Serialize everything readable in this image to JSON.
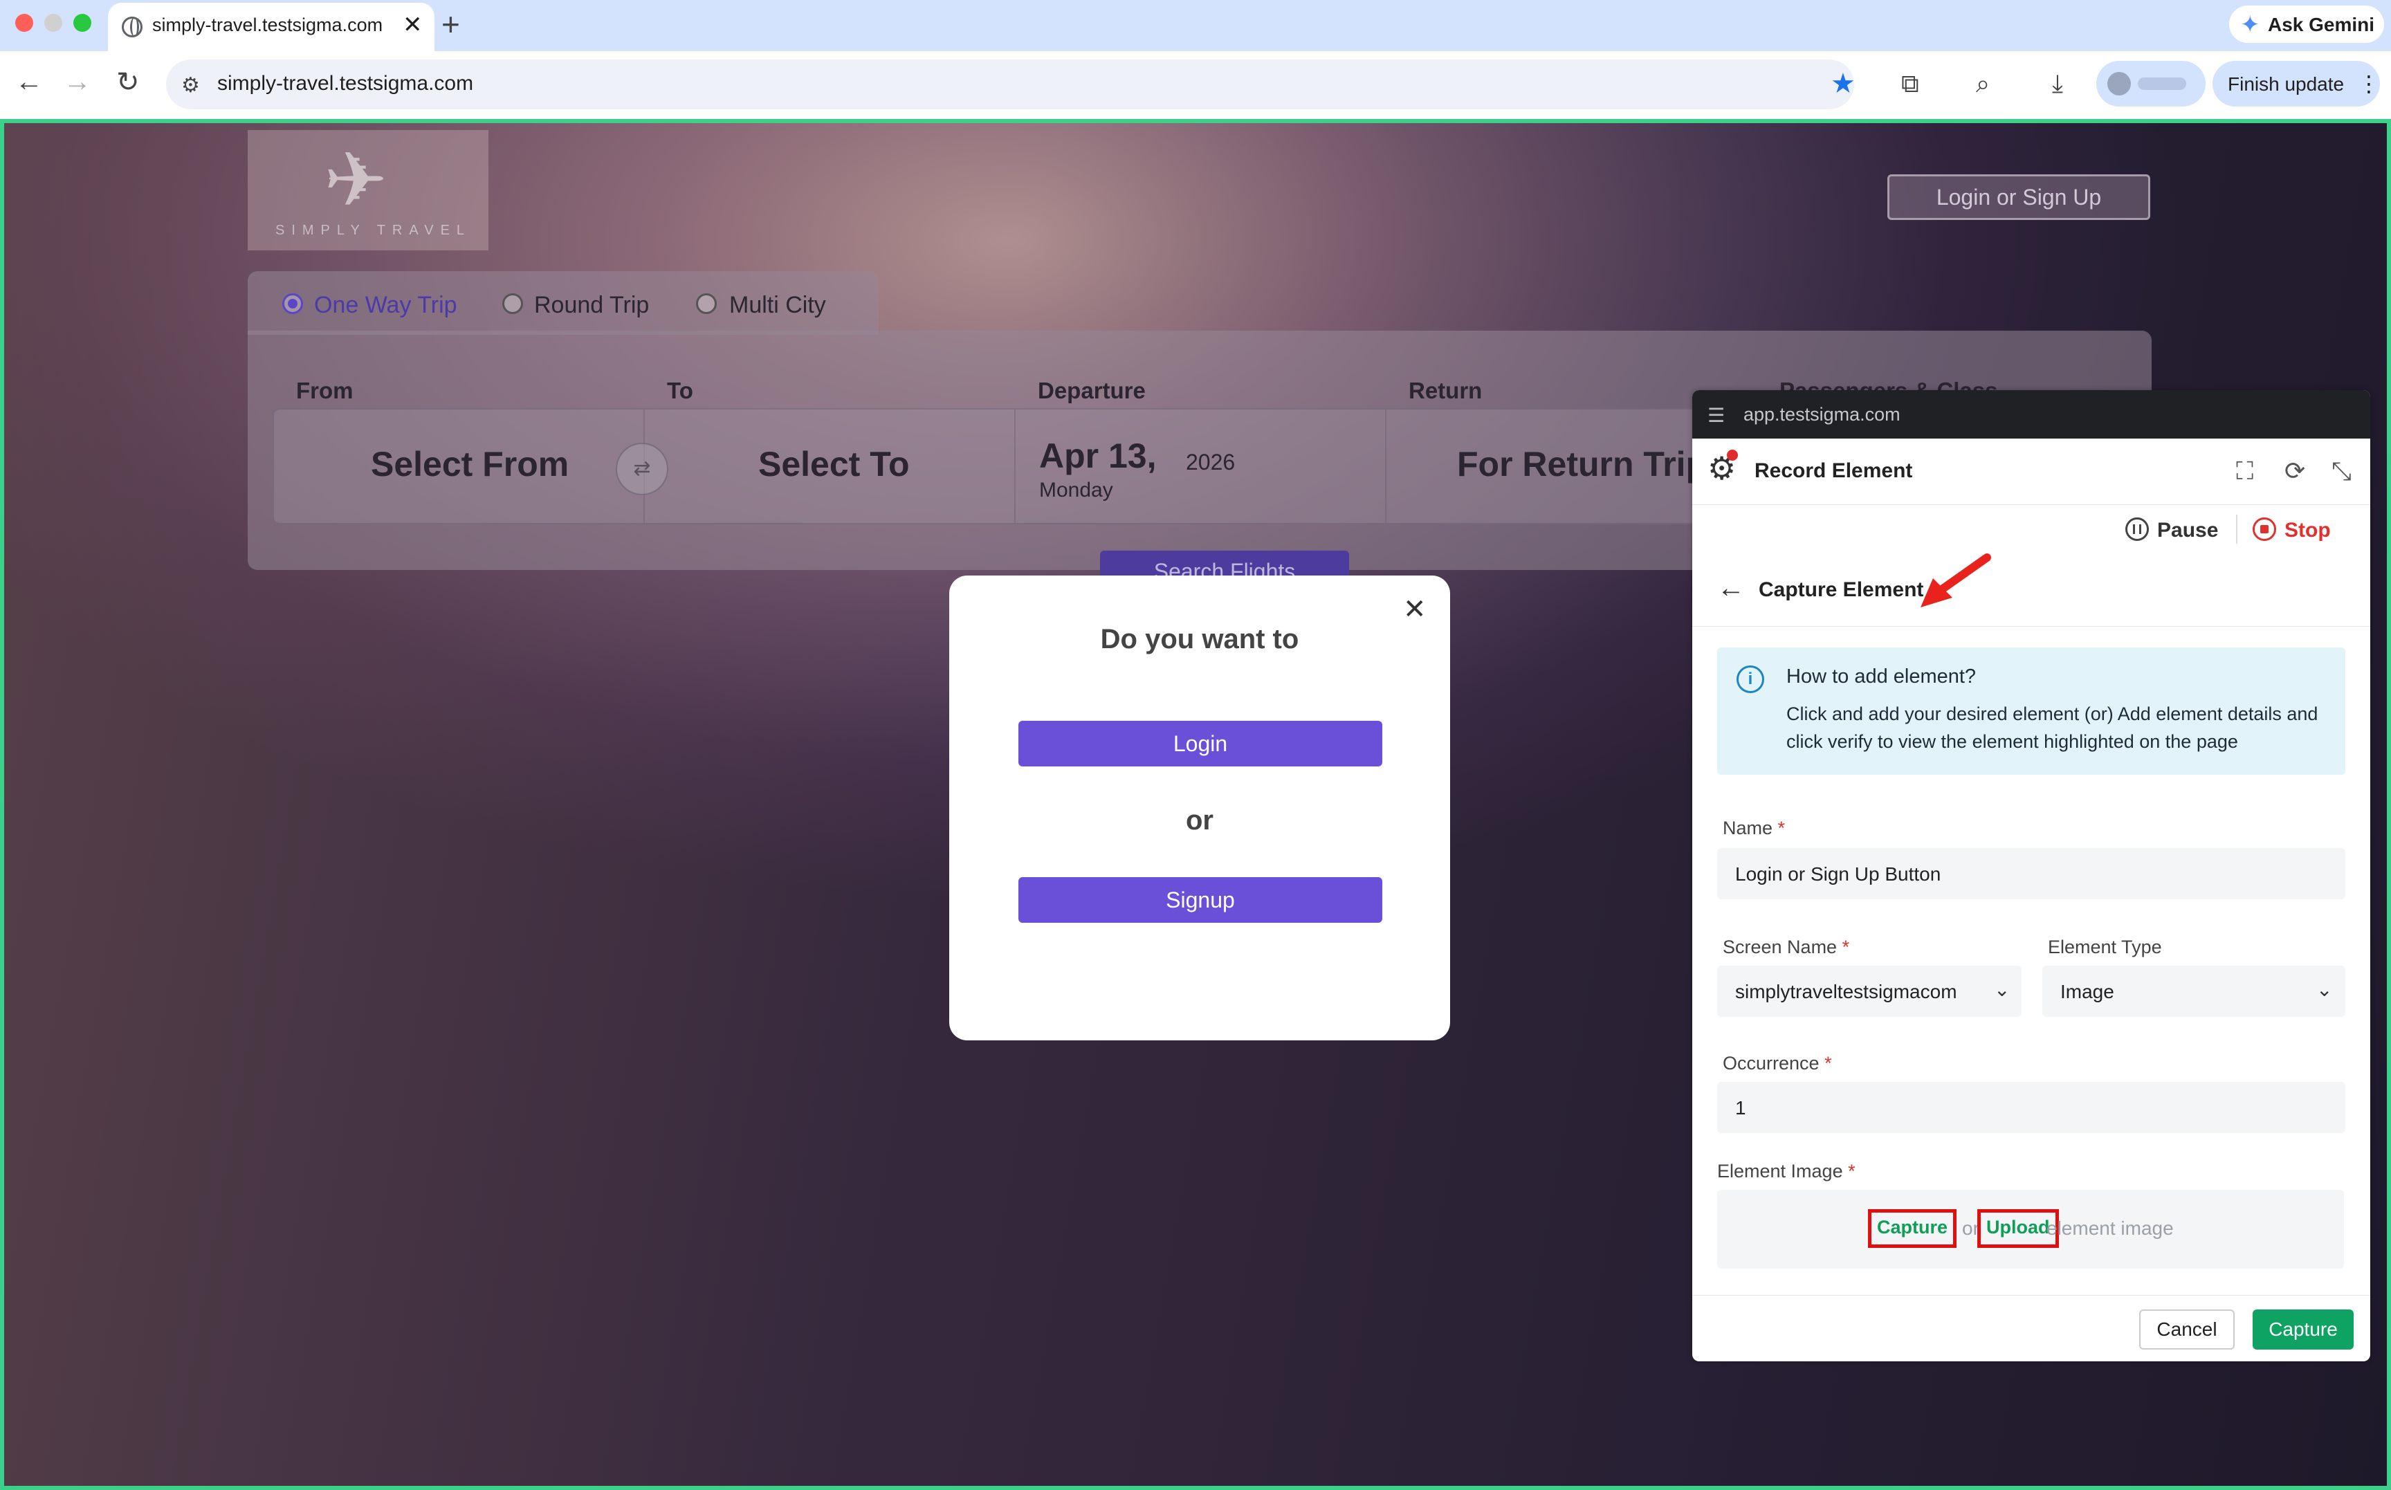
{
  "browser": {
    "tab_title": "simply-travel.testsigma.com",
    "new_tab": "+",
    "tab_close": "✕",
    "url": "simply-travel.testsigma.com",
    "gemini_label": "Ask Gemini",
    "finish_update_label": "Finish update"
  },
  "page": {
    "logo_text": "SIMPLY TRAVEL",
    "login_signup": "Login or Sign Up",
    "trip_types": [
      {
        "label": "One Way Trip",
        "selected": true
      },
      {
        "label": "Round Trip",
        "selected": false
      },
      {
        "label": "Multi City",
        "selected": false
      }
    ],
    "headers": {
      "from": "From",
      "to": "To",
      "departure": "Departure",
      "return": "Return",
      "passengers": "Passengers & Class"
    },
    "from_value": "Select From",
    "to_value": "Select To",
    "departure_date": "Apr 13,",
    "departure_year": "2026",
    "departure_day": "Monday",
    "return_value": "For Return Trip",
    "search_button": "Search Flights"
  },
  "modal": {
    "question": "Do you want to",
    "login": "Login",
    "or": "or",
    "signup": "Signup"
  },
  "testsigma": {
    "origin": "app.testsigma.com",
    "title": "Record Element",
    "pause": "Pause",
    "stop": "Stop",
    "section_title": "Capture Element",
    "info_heading": "How to add element?",
    "info_body": "Click and add your desired element (or) Add element details and click verify to view the element highlighted on the page",
    "name_label": "Name",
    "name_value": "Login or Sign Up Button",
    "screen_name_label": "Screen Name",
    "screen_name_value": "simplytraveltestsigmacom",
    "element_type_label": "Element Type",
    "element_type_value": "Image",
    "occurrence_label": "Occurrence",
    "occurrence_value": "1",
    "element_image_label": "Element Image",
    "capture_link": "Capture",
    "or_text": "or",
    "upload_link": "Upload",
    "image_hint": "element image",
    "required_mark": "*",
    "cancel": "Cancel",
    "capture_button": "Capture"
  },
  "colors": {
    "accent_purple": "#6a4fd9",
    "testsigma_green": "#0fa363",
    "stop_red": "#e0312d",
    "highlight_red": "#e01010",
    "viewport_border": "#3cd18b"
  }
}
